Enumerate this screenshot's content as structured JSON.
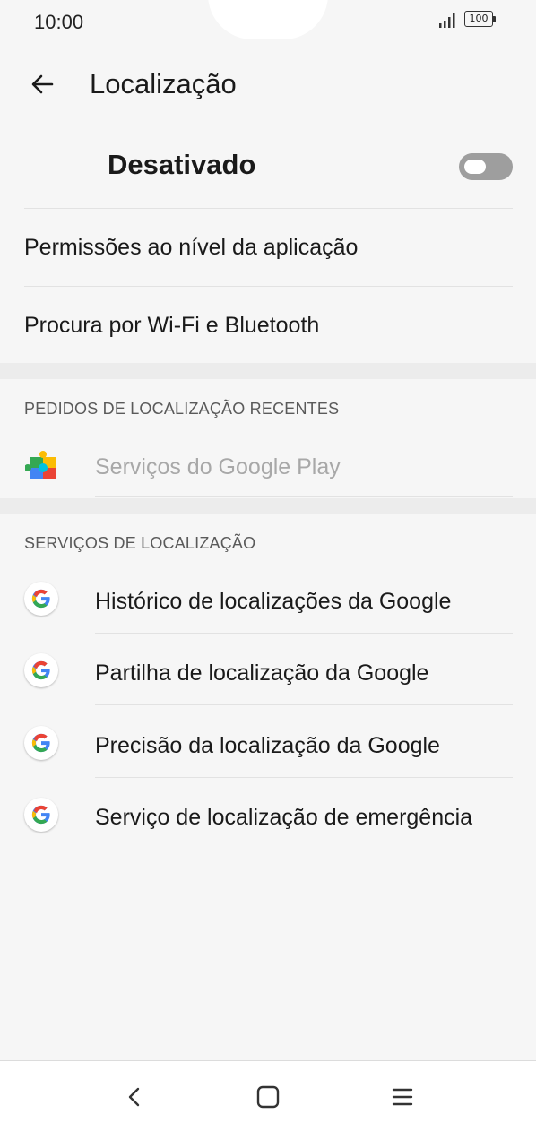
{
  "status_bar": {
    "time": "10:00",
    "battery": "100",
    "signal_icon": "signal-bars-icon",
    "battery_icon": "battery-icon"
  },
  "toolbar": {
    "back_icon": "arrow-left-icon",
    "title": "Localização"
  },
  "master_switch": {
    "label": "Desativado",
    "enabled": false
  },
  "settings_rows": [
    {
      "label": "Permissões ao nível da aplicação"
    },
    {
      "label": "Procura por Wi-Fi e Bluetooth"
    }
  ],
  "recent_requests": {
    "header": "PEDIDOS DE LOCALIZAÇÃO RECENTES",
    "items": [
      {
        "label": "Serviços do Google Play",
        "icon": "google-play-services-icon"
      }
    ]
  },
  "location_services": {
    "header": "SERVIÇOS DE LOCALIZAÇÃO",
    "items": [
      {
        "label": "Histórico de localizações da Google",
        "icon": "google-g-icon"
      },
      {
        "label": "Partilha de localização da Google",
        "icon": "google-g-icon"
      },
      {
        "label": "Precisão da localização da Google",
        "icon": "google-g-icon"
      },
      {
        "label": "Serviço de localização de emergência",
        "icon": "google-g-icon"
      }
    ]
  },
  "nav_bar": {
    "back_icon": "nav-back-icon",
    "home_icon": "nav-home-icon",
    "menu_icon": "nav-menu-icon"
  },
  "colors": {
    "background": "#f6f6f6",
    "toggle_off": "#9e9e9e",
    "divider": "#e2e2e2"
  }
}
